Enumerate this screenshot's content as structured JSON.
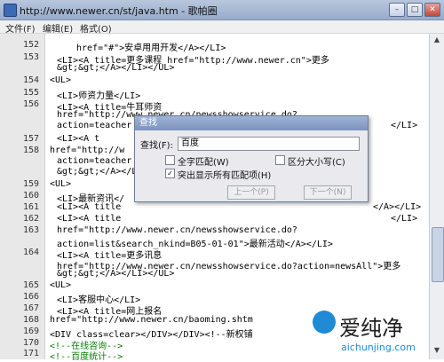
{
  "window": {
    "title": "http://www.newer.cn/st/java.htm - 歌帕圈"
  },
  "menu": [
    "文件(F)",
    "编辑(E)",
    "格式(O)"
  ],
  "editor": {
    "lines": [
      {
        "num": "152",
        "text": "href=\"#\">安卓用用开发</A></LI>"
      },
      {
        "num": "153",
        "text": "<LI><A title=更多课程 href=\"http://www.newer.cn\">更多"
      },
      {
        "num": "",
        "text": "&gt;&gt;</A></LI></UL>"
      },
      {
        "num": "154",
        "text": "<UL>"
      },
      {
        "num": "155",
        "text": "<LI>师资力量</LI>"
      },
      {
        "num": "156",
        "text": "<LI><A title=牛耳师资"
      },
      {
        "num": "",
        "text": "href=\"http://www.newer.cn/newsshowservice.do?"
      },
      {
        "num": "",
        "text": "action=teacher"
      },
      {
        "num": "157",
        "text": "<LI><A t"
      },
      {
        "num": "158",
        "text": "href=\"http://w"
      },
      {
        "num": "",
        "text": "action=teacher"
      },
      {
        "num": "",
        "text": "&gt;&gt;</A></LI>"
      },
      {
        "num": "159",
        "text": "<UL>"
      },
      {
        "num": "160",
        "text": "<LI>最新资讯</"
      },
      {
        "num": "161",
        "text": "<LI><A title"
      },
      {
        "num": "162",
        "text": "<LI><A title"
      },
      {
        "num": "163",
        "text": "href=\"http://www.newer.cn/newsshowservice.do?"
      },
      {
        "num": "",
        "text": "action=list&search_nkind=B05-01-01\">最新活动</A></LI>"
      },
      {
        "num": "164",
        "text": "<LI><A title=更多讯息"
      },
      {
        "num": "",
        "text": "href=\"http://www.newer.cn/newsshowservice.do?action=newsAll\">更多"
      },
      {
        "num": "",
        "text": "&gt;&gt;</A></LI></UL>"
      },
      {
        "num": "165",
        "text": "<UL>"
      },
      {
        "num": "166",
        "text": "<LI>客服中心</LI>"
      },
      {
        "num": "167",
        "text": "<LI><A title=网上报名"
      },
      {
        "num": "168",
        "text": "href=\"http://www.newer.cn/baoming.shtm"
      },
      {
        "num": "169",
        "text": "<DIV class=clear></DIV></DIV><!--新权铺"
      },
      {
        "num": "170",
        "text": "<!--在线咨询-->"
      },
      {
        "num": "171",
        "text": "<!--百度统计-->"
      }
    ],
    "right_fragments": {
      "line156": "</LI>",
      "line161": "</A></LI>",
      "line162": "</LI>"
    }
  },
  "find_dialog": {
    "title": "查找",
    "find_label": "查找(F):",
    "find_value": "百度",
    "match_whole_word": "全字匹配(W)",
    "match_case": "区分大小写(C)",
    "highlight_all": "突出显示所有匹配项(H)",
    "prev_button": "上一个(P)",
    "next_button": "下一个(N)"
  },
  "watermark": {
    "brand_cn": "爱纯净",
    "brand_en": "aichunjing.com",
    "logo_color": "#1f8ad6"
  }
}
